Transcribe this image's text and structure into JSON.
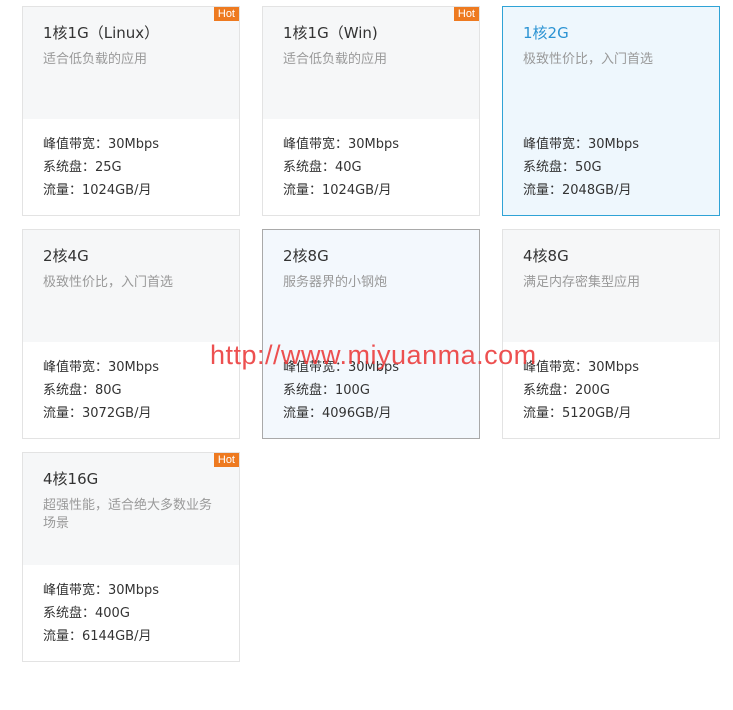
{
  "plans": [
    {
      "name": "1核1G（Linux）",
      "desc": "适合低负载的应用",
      "bandwidth": "峰值带宽：30Mbps",
      "disk": "系统盘：25G",
      "traffic": "流量：1024GB/月",
      "hot": "Hot"
    },
    {
      "name": "1核1G（Win)",
      "desc": "适合低负载的应用",
      "bandwidth": "峰值带宽：30Mbps",
      "disk": "系统盘：40G",
      "traffic": "流量：1024GB/月",
      "hot": "Hot"
    },
    {
      "name": "1核2G",
      "desc": "极致性价比，入门首选",
      "bandwidth": "峰值带宽：30Mbps",
      "disk": "系统盘：50G",
      "traffic": "流量：2048GB/月",
      "state": "selected"
    },
    {
      "name": "2核4G",
      "desc": "极致性价比，入门首选",
      "bandwidth": "峰值带宽：30Mbps",
      "disk": "系统盘：80G",
      "traffic": "流量：3072GB/月"
    },
    {
      "name": "2核8G",
      "desc": "服务器界的小钢炮",
      "bandwidth": "峰值带宽：30Mbps",
      "disk": "系统盘：100G",
      "traffic": "流量：4096GB/月",
      "state": "hover"
    },
    {
      "name": "4核8G",
      "desc": "满足内存密集型应用",
      "bandwidth": "峰值带宽：30Mbps",
      "disk": "系统盘：200G",
      "traffic": "流量：5120GB/月"
    },
    {
      "name": "4核16G",
      "desc": "超强性能，适合绝大多数业务场景",
      "bandwidth": "峰值带宽：30Mbps",
      "disk": "系统盘：400G",
      "traffic": "流量：6144GB/月",
      "hot": "Hot"
    }
  ],
  "watermark": "http://www.miyuanma.com",
  "colors": {
    "hot_badge": "#ee7a20",
    "selected_border": "#2fa3d6",
    "selected_title": "#2b93d3",
    "watermark": "#eb3838"
  }
}
